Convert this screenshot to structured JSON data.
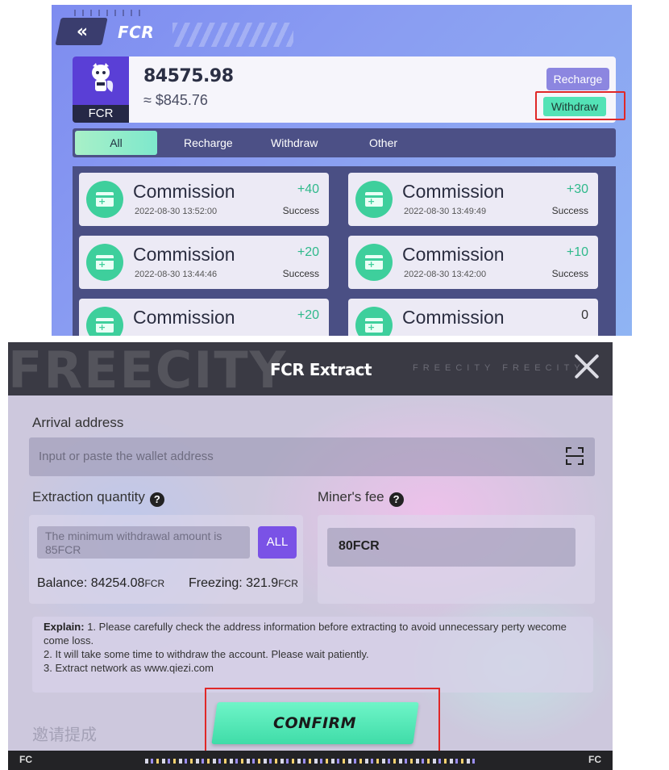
{
  "top": {
    "header_title": "FCR",
    "back_symbol": "«",
    "token": {
      "logo_label": "FCR",
      "amount": "84575.98",
      "usd_value": "≈ $845.76",
      "recharge_label": "Recharge",
      "withdraw_label": "Withdraw"
    },
    "tabs": [
      "All",
      "Recharge",
      "Withdraw",
      "Other"
    ],
    "records": [
      {
        "title": "Commission",
        "date": "2022-08-30 13:52:00",
        "amount": "+40",
        "status": "Success"
      },
      {
        "title": "Commission",
        "date": "2022-08-30 13:49:49",
        "amount": "+30",
        "status": "Success"
      },
      {
        "title": "Commission",
        "date": "2022-08-30 13:44:46",
        "amount": "+20",
        "status": "Success"
      },
      {
        "title": "Commission",
        "date": "2022-08-30 13:42:00",
        "amount": "+10",
        "status": "Success"
      },
      {
        "title": "Commission",
        "date": "",
        "amount": "+20",
        "status": ""
      },
      {
        "title": "Commission",
        "date": "",
        "amount": "0",
        "status": ""
      }
    ]
  },
  "modal": {
    "background_word": "FREECITY",
    "background_small": "FREECITY  FREECITY",
    "title": "FCR Extract",
    "arrival_label": "Arrival address",
    "address_placeholder": "Input or paste the wallet address",
    "quantity_label": "Extraction quantity",
    "quantity_placeholder": "The minimum withdrawal amount is 85FCR",
    "all_label": "ALL",
    "balance_label": "Balance:",
    "balance_value": "84254.08",
    "balance_unit": "FCR",
    "freezing_label": "Freezing:",
    "freezing_value": "321.9",
    "freezing_unit": "FCR",
    "fee_label": "Miner's fee",
    "fee_value": "80FCR",
    "explain_key": "Explain:",
    "explain_1": "1. Please carefully check the address information before extracting to avoid unnecessary perty wecome come loss.",
    "explain_2": "2. It will take some time to withdraw the account. Please wait patiently.",
    "explain_3": "3. Extract network as www.qiezi.com",
    "confirm_label": "CONFIRM",
    "ghost_text": "邀请提成",
    "footer_left": "FC",
    "footer_right": "FC"
  },
  "colors": {
    "accent_green": "#53e3b6",
    "purple_button": "#7a52e6",
    "highlight_red": "#e02828"
  }
}
